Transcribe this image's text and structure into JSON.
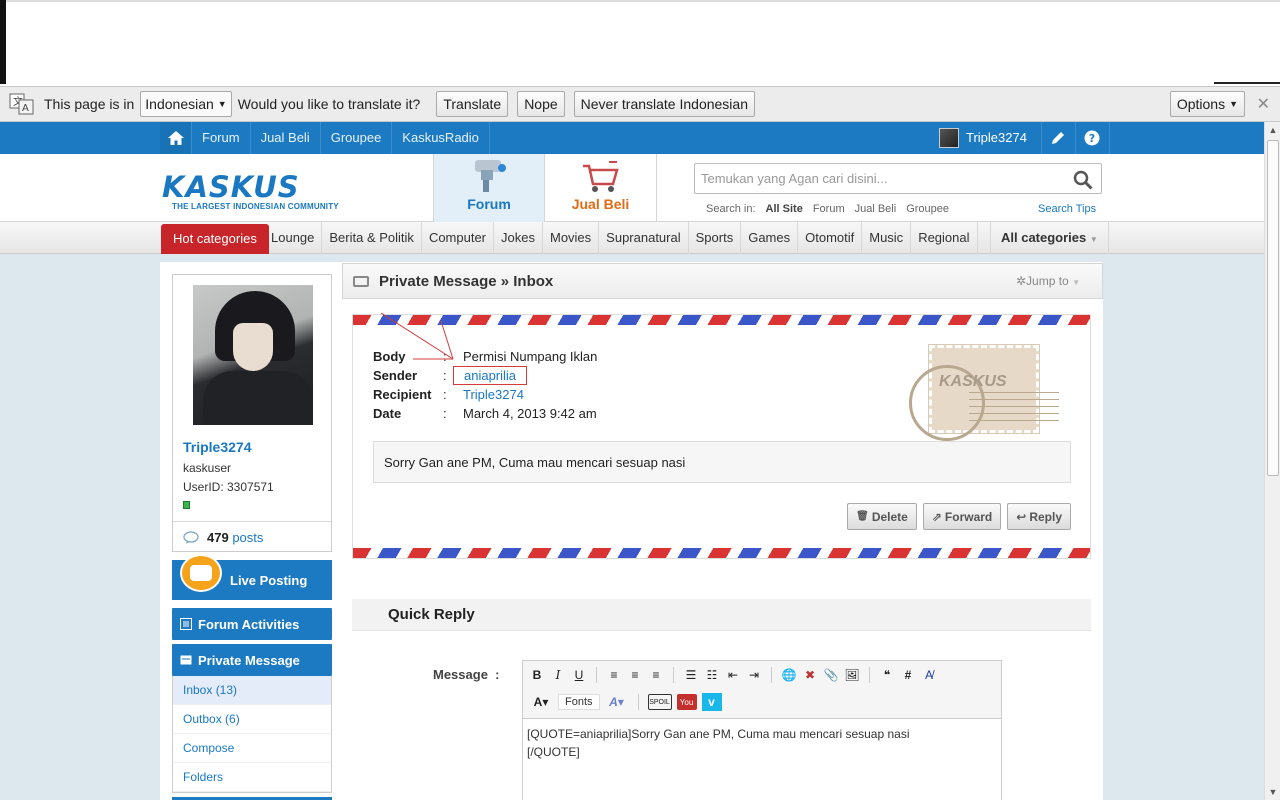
{
  "translate_bar": {
    "prefix": "This page is in",
    "language": "Indonesian",
    "question": "Would you like to translate it?",
    "translate_label": "Translate",
    "nope_label": "Nope",
    "never_label": "Never translate Indonesian",
    "options_label": "Options",
    "close": "✕"
  },
  "nav": {
    "items": [
      "Forum",
      "Jual Beli",
      "Groupee",
      "KaskusRadio"
    ],
    "username": "Triple3274"
  },
  "header": {
    "logo_text": "KASKUS",
    "logo_tagline": "THE LARGEST INDONESIAN COMMUNITY",
    "tab_forum": "Forum",
    "tab_jualbeli": "Jual Beli",
    "search_placeholder": "Temukan yang Agan cari disini...",
    "search_in_label": "Search in:",
    "search_in_options": [
      "All Site",
      "Forum",
      "Jual Beli",
      "Groupee"
    ],
    "search_tips": "Search Tips"
  },
  "categories": {
    "hot": "Hot categories",
    "items": [
      "Lounge",
      "Berita & Politik",
      "Computer",
      "Jokes",
      "Movies",
      "Supranatural",
      "Sports",
      "Games",
      "Otomotif",
      "Music",
      "Regional"
    ],
    "all": "All categories"
  },
  "profile": {
    "name": "Triple3274",
    "role": "kaskuser",
    "userid": "UserID: 3307571",
    "posts_count": "479",
    "posts_label": "posts"
  },
  "sidebar": {
    "live_posting": "Live Posting",
    "forum_activities": "Forum Activities",
    "private_message": "Private Message",
    "pm_items": [
      "Inbox (13)",
      "Outbox (6)",
      "Compose",
      "Folders"
    ]
  },
  "main": {
    "title": "Private Message » Inbox",
    "jump_to": "Jump to",
    "fields": {
      "body_label": "Body",
      "body_value": "Permisi Numpang Iklan",
      "sender_label": "Sender",
      "sender_value": "aniaprilia",
      "recipient_label": "Recipient",
      "recipient_value": "Triple3274",
      "date_label": "Date",
      "date_value": "March 4, 2013 9:42 am"
    },
    "stamp_text": "KASKUS",
    "message": "Sorry Gan ane PM, Cuma mau mencari sesuap nasi",
    "delete_label": "Delete",
    "forward_label": "Forward",
    "reply_label": "Reply"
  },
  "quick_reply": {
    "title": "Quick Reply",
    "message_label": "Message",
    "fonts_label": "Fonts",
    "editor_text_line1": "[QUOTE=aniaprilia]Sorry Gan ane PM, Cuma mau mencari sesuap nasi",
    "editor_text_line2": "[/QUOTE]"
  }
}
